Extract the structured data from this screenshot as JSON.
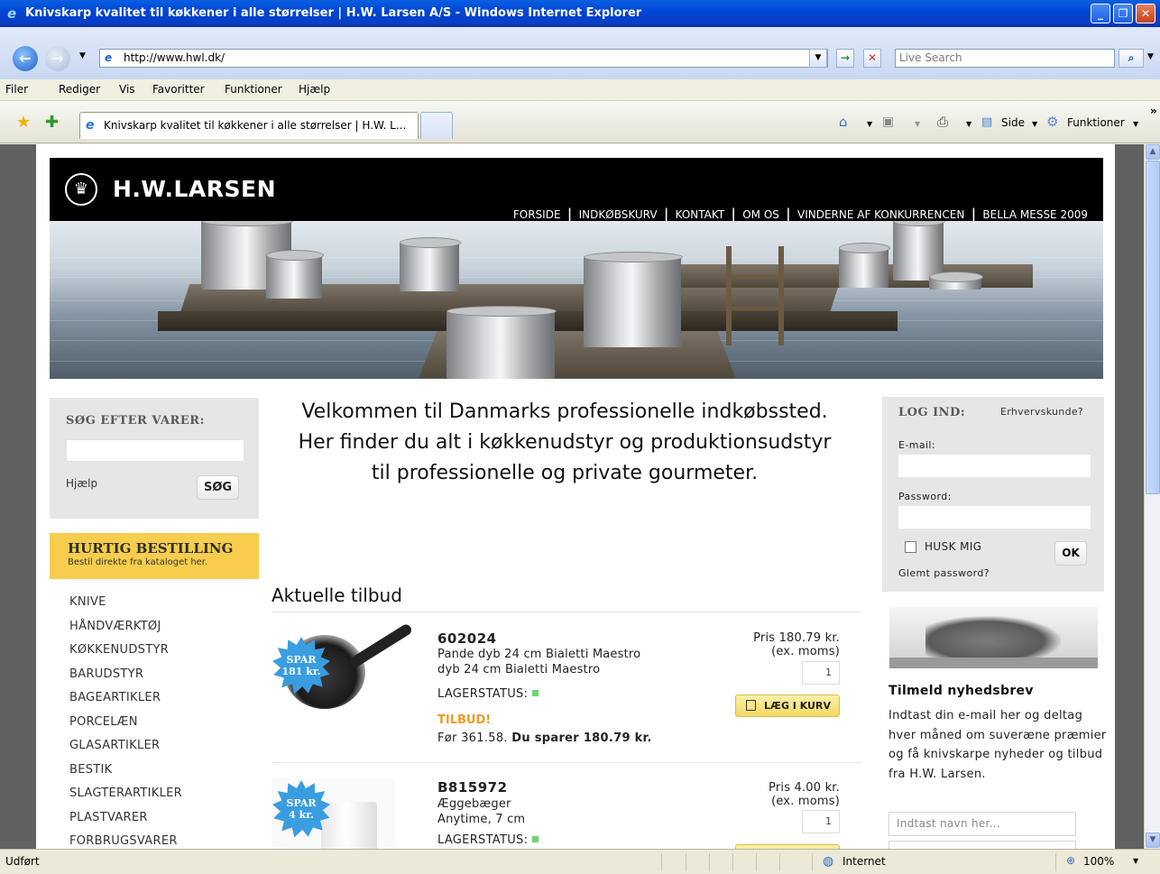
{
  "window": {
    "title": "Knivskarp kvalitet til køkkener i alle størrelser | H.W. Larsen A/S - Windows Internet Explorer",
    "minimize": "_",
    "restore": "❐",
    "close": "✕"
  },
  "addressbar": {
    "url": "http://www.hwl.dk/",
    "search_placeholder": "Live Search"
  },
  "menu": [
    "Filer",
    "Rediger",
    "Vis",
    "Favoritter",
    "Funktioner",
    "Hjælp"
  ],
  "tab": {
    "label": "Knivskarp kvalitet til køkkener i alle størrelser | H.W. L..."
  },
  "commandbar": {
    "side": "Side",
    "funktioner": "Funktioner"
  },
  "status": {
    "left": "Udført",
    "zone": "Internet",
    "zoom": "100%"
  },
  "site": {
    "logo": "H.W.LARSEN",
    "nav": [
      "FORSIDE",
      "INDKØBSKURV",
      "KONTAKT",
      "OM OS",
      "VINDERNE AF KONKURRENCEN",
      "BELLA MESSE 2009"
    ],
    "search": {
      "heading": "SØG EFTER VARER:",
      "help": "Hjælp",
      "button": "SØG"
    },
    "quick_order": {
      "title": "HURTIG BESTILLING",
      "subtitle": "Bestil direkte fra kataloget her."
    },
    "categories": [
      "KNIVE",
      "HÅNDVÆRKTØJ",
      "KØKKENUDSTYR",
      "BARUDSTYR",
      "BAGEARTIKLER",
      "PORCELÆN",
      "GLASARTIKLER",
      "BESTIK",
      "SLAGTERARTIKLER",
      "PLASTVARER",
      "FORBRUGSVARER"
    ],
    "welcome": [
      "Velkommen til Danmarks professionelle indkøbssted.",
      "Her finder du alt i køkkenudstyr og produktionsudstyr",
      "til professionelle og private gourmeter."
    ],
    "offers_heading": "Aktuelle tilbud",
    "products": [
      {
        "badge_top": "SPAR",
        "badge_bottom": "181 kr.",
        "code": "602024",
        "desc1": "Pande dyb 24 cm Bialetti Maestro",
        "desc2": "dyb 24 cm Bialetti Maestro",
        "lager": "LAGERSTATUS:",
        "tilbud": "TILBUD!",
        "foer": "Før 361.58.",
        "spar_text": "Du sparer 180.79 kr.",
        "price": "Pris 180.79 kr.",
        "moms": "(ex. moms)",
        "qty": "1",
        "cart": "LÆG I KURV"
      },
      {
        "badge_top": "SPAR",
        "badge_bottom": "4 kr.",
        "code": "B815972",
        "desc1": "Æggebæger",
        "desc2": "Anytime, 7 cm",
        "lager": "LAGERSTATUS:",
        "price": "Pris 4.00 kr.",
        "moms": "(ex. moms)",
        "qty": "1"
      }
    ],
    "login": {
      "heading": "LOG IND:",
      "business": "Erhvervskunde?",
      "email_label": "E-mail:",
      "password_label": "Password:",
      "remember": "HUSK MIG",
      "ok": "OK",
      "forgot": "Glemt password?"
    },
    "newsletter": {
      "heading": "Tilmeld nyhedsbrev",
      "text": "Indtast din e-mail her og deltag hver måned om suveræne præmier og få knivskarpe nyheder og tilbud fra H.W. Larsen.",
      "name_placeholder": "Indtast navn her..."
    }
  },
  "colors": {
    "xp_blue": "#0046d5",
    "quick_order_yellow": "#f6cd4d",
    "tilbud_orange": "#f09a22",
    "badge_blue": "#3a9de0",
    "stock_green": "#6ed56e"
  }
}
